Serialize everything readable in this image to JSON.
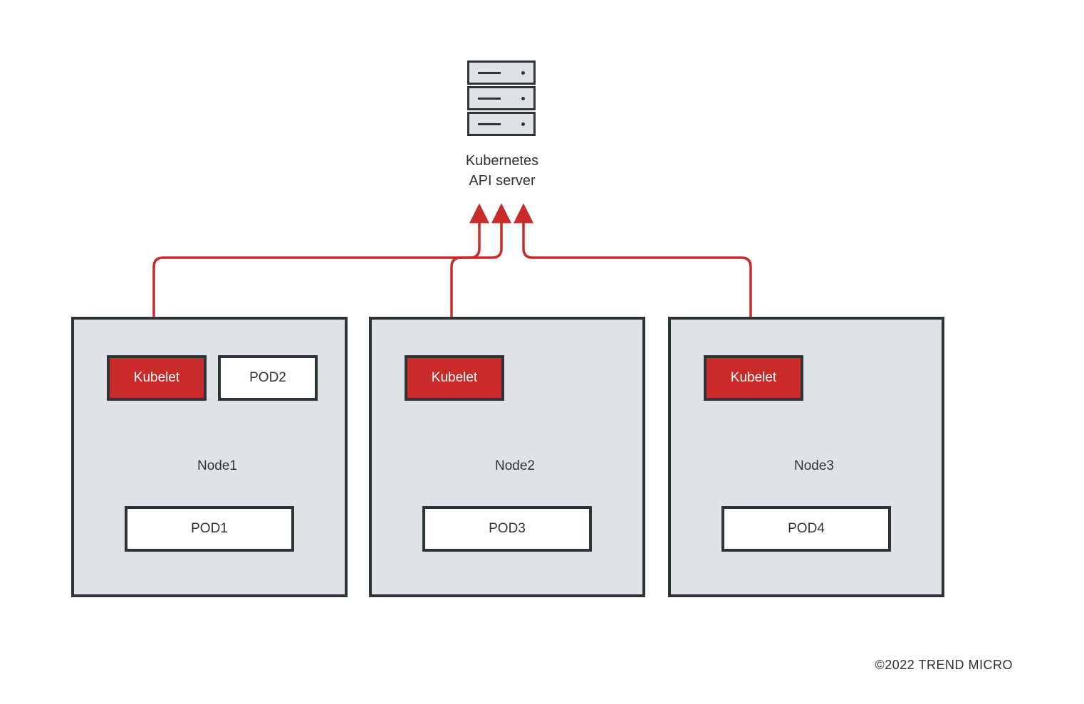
{
  "api_server": {
    "label_line1": "Kubernetes",
    "label_line2": "API server"
  },
  "nodes": [
    {
      "kubelet_label": "Kubelet",
      "node_label": "Node1",
      "pod_bottom_label": "POD1",
      "pod_extra_label": "POD2"
    },
    {
      "kubelet_label": "Kubelet",
      "node_label": "Node2",
      "pod_bottom_label": "POD3"
    },
    {
      "kubelet_label": "Kubelet",
      "node_label": "Node3",
      "pod_bottom_label": "POD4"
    }
  ],
  "footer": "©2022 TREND MICRO",
  "colors": {
    "kubelet_bg": "#c92a2a",
    "node_bg": "#dfe3e8",
    "border": "#2d3436",
    "arrow": "#c92a2a"
  }
}
